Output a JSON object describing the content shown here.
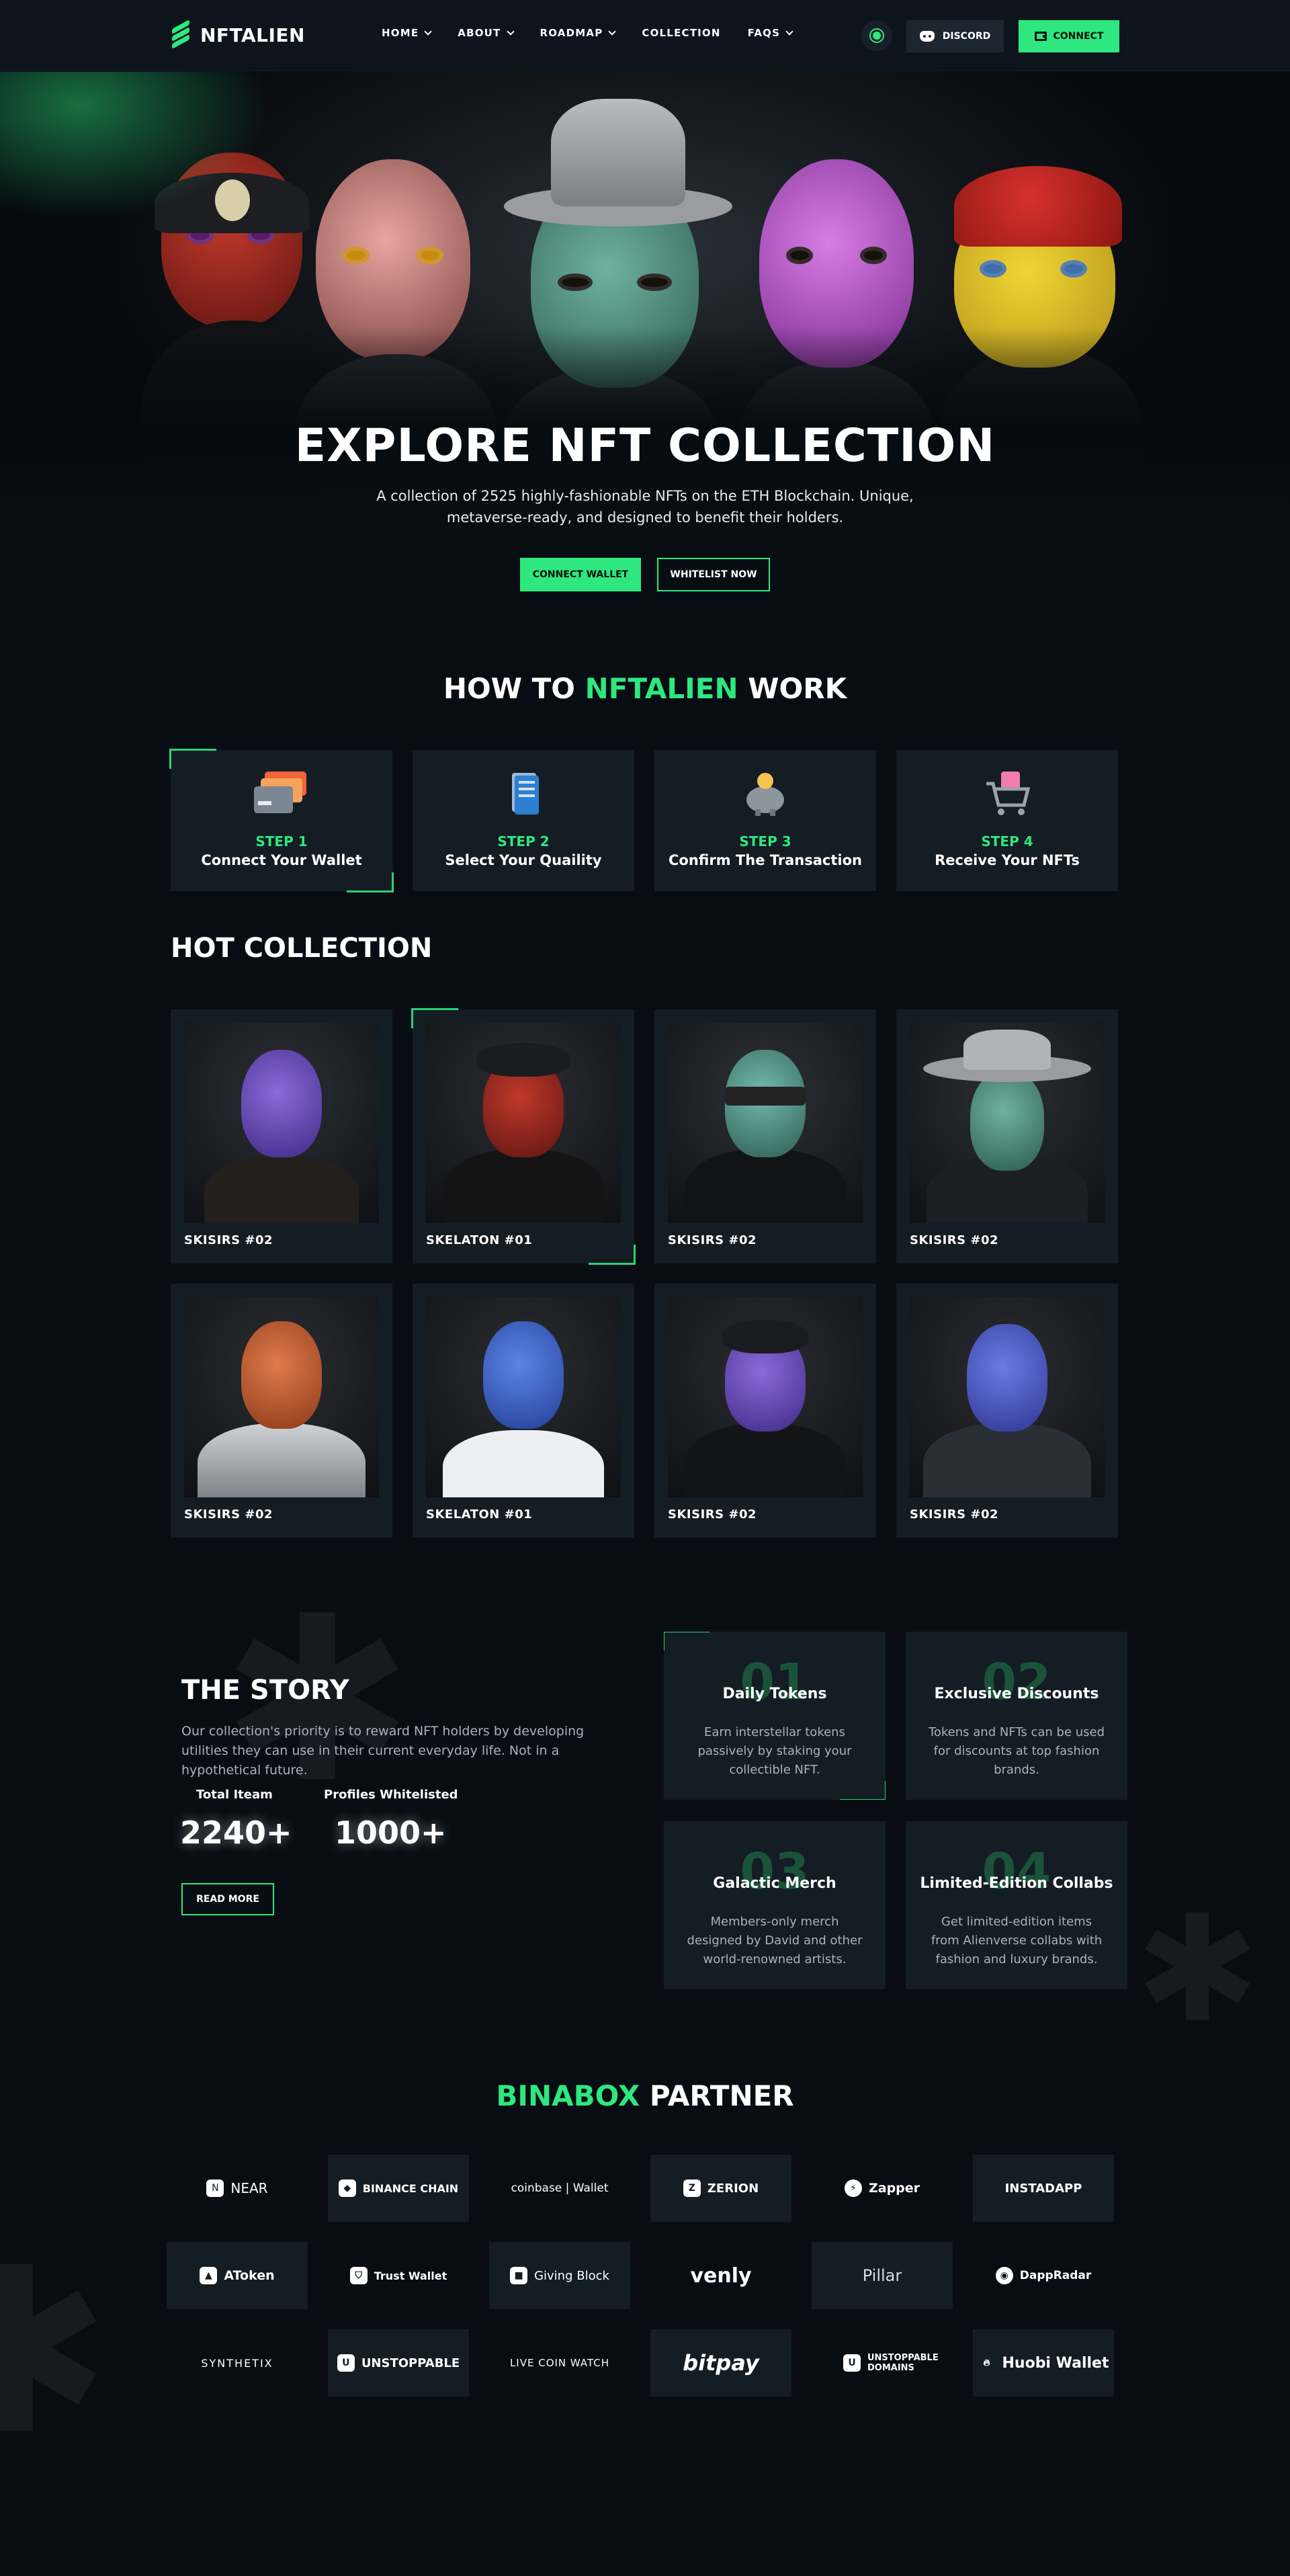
{
  "nav": {
    "brand": "NFTALIEN",
    "menu": [
      {
        "label": "HOME",
        "has_dropdown": true
      },
      {
        "label": "ABOUT",
        "has_dropdown": true
      },
      {
        "label": "ROADMAP",
        "has_dropdown": true
      },
      {
        "label": "COLLECTION",
        "has_dropdown": false
      },
      {
        "label": "FAQS",
        "has_dropdown": true
      }
    ],
    "discord_label": "DISCORD",
    "connect_label": "CONNECT"
  },
  "hero": {
    "title": "EXPLORE NFT COLLECTION",
    "subtitle": "A collection of 2525 highly-fashionable NFTs on the ETH Blockchain. Unique, metaverse-ready, and designed to benefit their holders.",
    "primary_button": "CONNECT WALLET",
    "secondary_button": "WHITELIST NOW"
  },
  "how_to": {
    "title_prefix": "HOW TO ",
    "title_accent": "NFTALIEN",
    "title_suffix": " WORK",
    "steps": [
      {
        "num": "STEP 1",
        "label": "Connect Your Wallet",
        "icon": "wallet-cards-icon"
      },
      {
        "num": "STEP 2",
        "label": "Select Your Quaility",
        "icon": "document-stack-icon"
      },
      {
        "num": "STEP 3",
        "label": "Confirm The Transaction",
        "icon": "piggy-bank-icon"
      },
      {
        "num": "STEP 4",
        "label": "Receive Your NFTs",
        "icon": "shopping-cart-icon"
      }
    ]
  },
  "hot_collection": {
    "title": "HOT COLLECTION",
    "items": [
      {
        "name": "SKISIRS #02"
      },
      {
        "name": "SKELATON #01"
      },
      {
        "name": "SKISIRS #02"
      },
      {
        "name": "SKISIRS #02"
      },
      {
        "name": "SKISIRS #02"
      },
      {
        "name": "SKELATON #01"
      },
      {
        "name": "SKISIRS #02"
      },
      {
        "name": "SKISIRS #02"
      }
    ]
  },
  "story": {
    "title": "THE STORY",
    "text": "Our collection's priority is to reward NFT holders by developing utilities they can use in their current everyday life. Not in a hypothetical future.",
    "stats": [
      {
        "label": "Total Iteam",
        "value": "2240+"
      },
      {
        "label": "Profiles Whitelisted",
        "value": "1000+"
      }
    ],
    "read_more": "READ MORE",
    "features": [
      {
        "num": "01",
        "title": "Daily Tokens",
        "desc": "Earn interstellar tokens passively by staking your collectible NFT."
      },
      {
        "num": "02",
        "title": "Exclusive Discounts",
        "desc": "Tokens and NFTs can be used for discounts at top fashion brands."
      },
      {
        "num": "03",
        "title": "Galactic Merch",
        "desc": "Members-only merch designed by David and other world-renowned artists."
      },
      {
        "num": "04",
        "title": "Limited-Edition Collabs",
        "desc": "Get limited-edition items from Alienverse collabs with fashion and luxury brands."
      }
    ]
  },
  "partners": {
    "title_accent": "BINABOX",
    "title_suffix": " PARTNER",
    "rows": [
      [
        {
          "name": "NEAR",
          "boxed": false
        },
        {
          "name": "BINANCE CHAIN",
          "boxed": true
        },
        {
          "name": "coinbase | Wallet",
          "boxed": false
        },
        {
          "name": "ZERION",
          "boxed": true
        },
        {
          "name": "Zapper",
          "boxed": false
        },
        {
          "name": "INSTADAPP",
          "boxed": true
        }
      ],
      [
        {
          "name": "AToken",
          "boxed": true
        },
        {
          "name": "Trust Wallet",
          "boxed": false
        },
        {
          "name": "Giving Block",
          "boxed": true
        },
        {
          "name": "venly",
          "boxed": false
        },
        {
          "name": "Pillar",
          "boxed": true
        },
        {
          "name": "DappRadar",
          "boxed": false
        }
      ],
      [
        {
          "name": "SYNTHETIX",
          "boxed": false
        },
        {
          "name": "UNSTOPPABLE",
          "boxed": true
        },
        {
          "name": "LIVE COIN WATCH",
          "boxed": false
        },
        {
          "name": "bitpay",
          "boxed": true
        },
        {
          "name": "UNSTOPPABLE DOMAINS",
          "boxed": false
        },
        {
          "name": "Huobi Wallet",
          "boxed": true
        }
      ]
    ]
  },
  "colors": {
    "accent": "#2ee87f",
    "background": "#070d13",
    "card": "#141c24"
  }
}
